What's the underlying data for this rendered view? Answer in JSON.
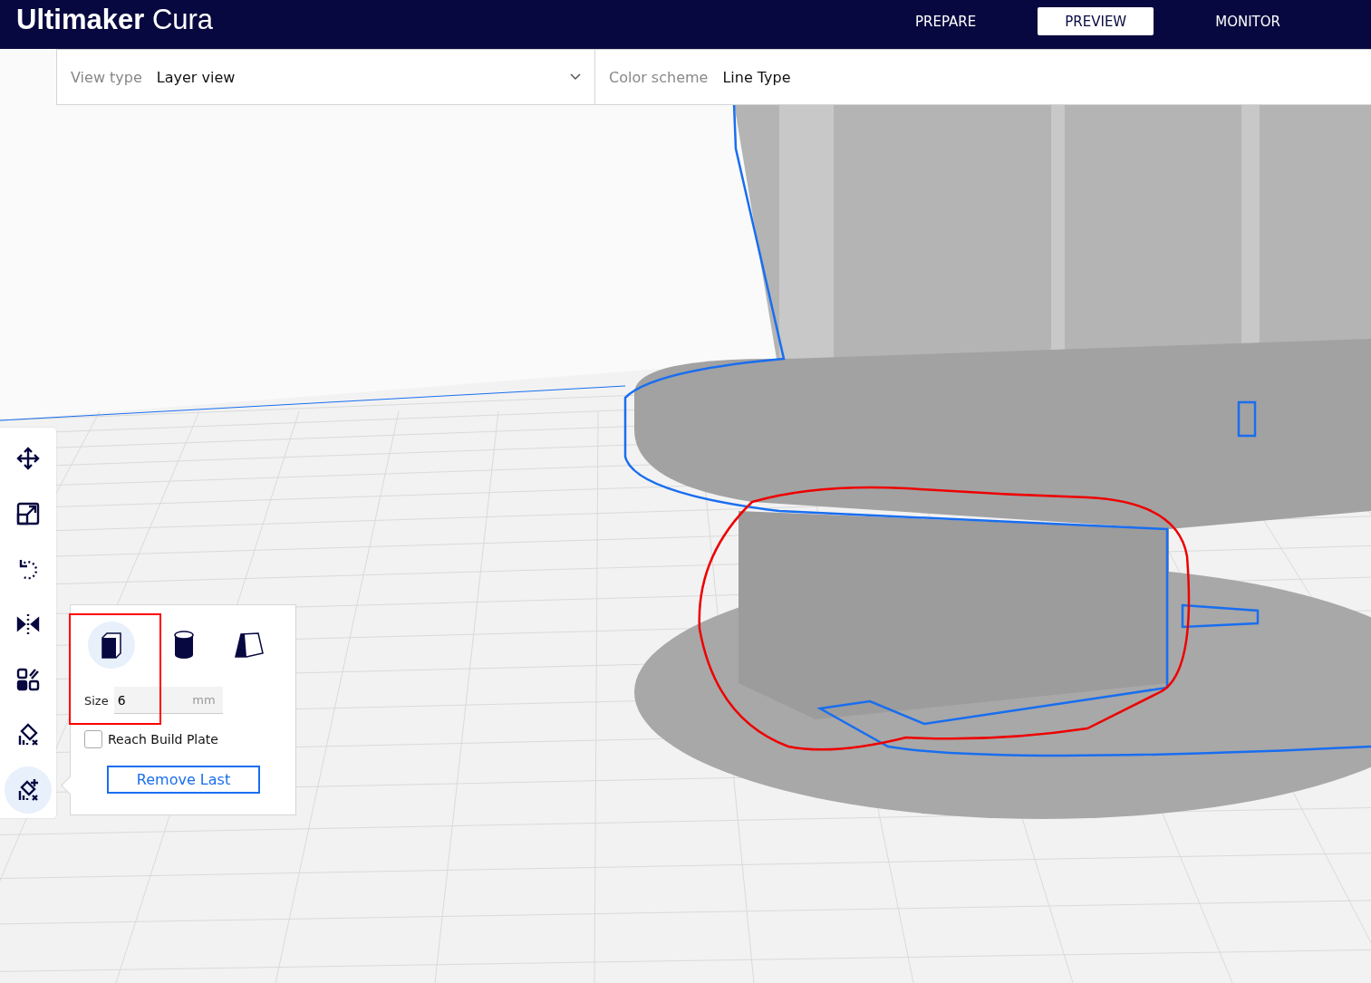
{
  "app": {
    "logo": "**Ultimaker** Cura"
  },
  "stage_tabs": [
    {
      "label": "PREPARE",
      "selected": false
    },
    {
      "label": "PREVIEW",
      "selected": true
    },
    {
      "label": "MONITOR",
      "selected": false
    }
  ],
  "view_bar": {
    "view_type": {
      "label": "View type",
      "value": "Layer view"
    },
    "color_scheme": {
      "label": "Color scheme",
      "value": "Line Type"
    }
  },
  "tools": [
    {
      "kind": "move",
      "selected": false
    },
    {
      "kind": "scale",
      "selected": false
    },
    {
      "kind": "rotate",
      "selected": false
    },
    {
      "kind": "mirror",
      "selected": false
    },
    {
      "kind": "per-model",
      "selected": false
    },
    {
      "kind": "support-blocker",
      "selected": false
    },
    {
      "kind": "custom-support",
      "selected": true
    }
  ],
  "support_panel": {
    "shapes": [
      {
        "kind": "cube",
        "selected": true
      },
      {
        "kind": "cylinder",
        "selected": false
      },
      {
        "kind": "custom",
        "selected": false
      }
    ],
    "size": {
      "label": "Size",
      "value": "6",
      "unit": "mm"
    },
    "reach_build_plate": {
      "label": "Reach Build Plate",
      "checked": false
    },
    "remove_button": "Remove Last"
  }
}
